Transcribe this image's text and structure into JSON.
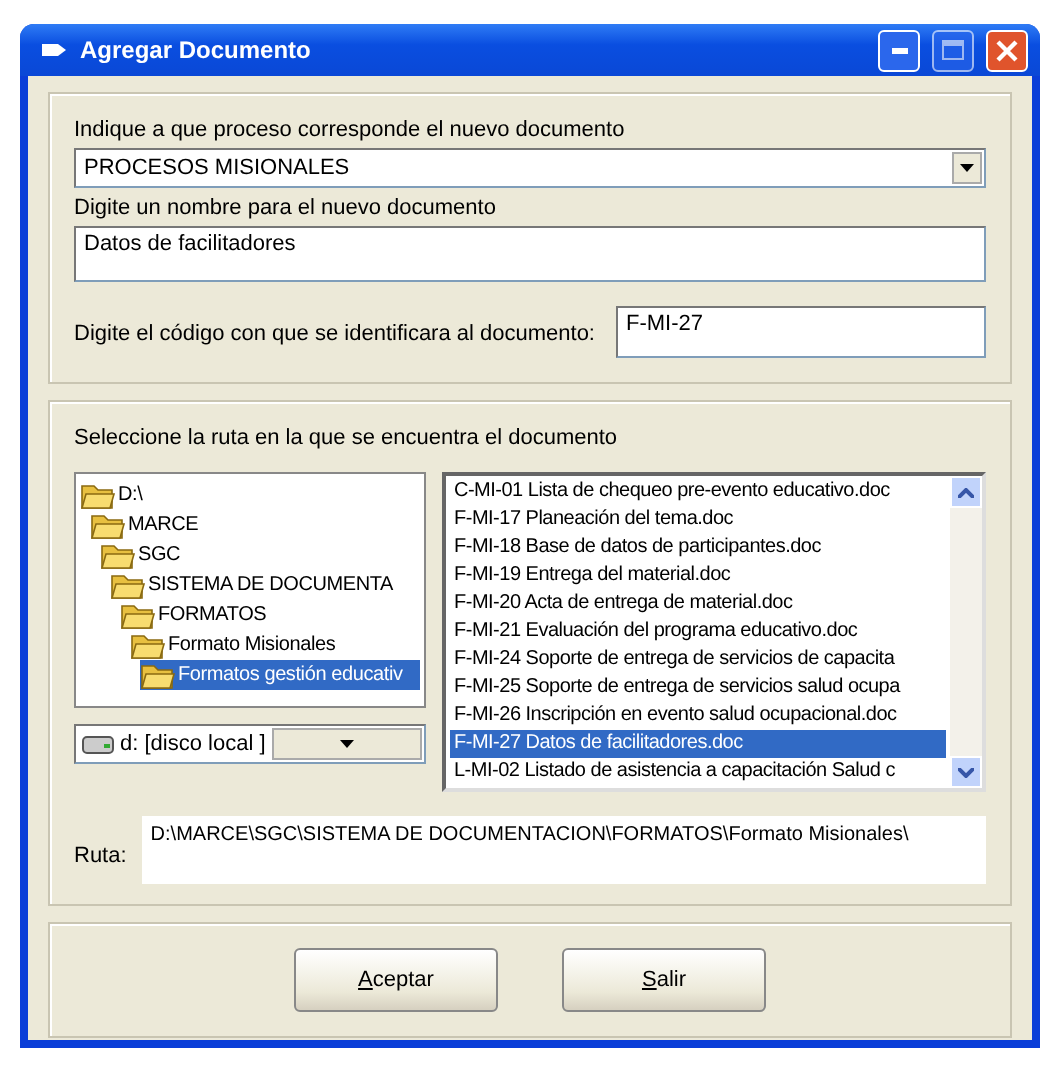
{
  "window": {
    "title": "Agregar Documento"
  },
  "process": {
    "label": "Indique a que proceso corresponde el nuevo documento",
    "value": "PROCESOS MISIONALES"
  },
  "name": {
    "label": "Digite un nombre para el nuevo documento",
    "value": "Datos de facilitadores"
  },
  "code": {
    "label": "Digite el código con que se identificara al documento:",
    "value": "F-MI-27"
  },
  "location": {
    "label": "Seleccione la ruta en la que se encuentra el documento",
    "folders": [
      {
        "label": "D:\\",
        "selected": false,
        "children": [
          {
            "label": "MARCE",
            "selected": false,
            "children": [
              {
                "label": "SGC",
                "selected": false,
                "children": [
                  {
                    "label": "SISTEMA DE DOCUMENTA",
                    "selected": false,
                    "children": [
                      {
                        "label": "FORMATOS",
                        "selected": false,
                        "children": [
                          {
                            "label": "Formato Misionales",
                            "selected": false,
                            "children": [
                              {
                                "label": "Formatos gestión educativ",
                                "selected": true
                              }
                            ]
                          }
                        ]
                      }
                    ]
                  }
                ]
              }
            ]
          }
        ]
      }
    ],
    "drive": "d: [disco local ]",
    "files": [
      {
        "name": "C-MI-01 Lista de chequeo pre-evento educativo.doc",
        "selected": false
      },
      {
        "name": "F-MI-17 Planeación del tema.doc",
        "selected": false
      },
      {
        "name": "F-MI-18 Base de datos de participantes.doc",
        "selected": false
      },
      {
        "name": "F-MI-19 Entrega del material.doc",
        "selected": false
      },
      {
        "name": "F-MI-20 Acta de entrega de material.doc",
        "selected": false
      },
      {
        "name": "F-MI-21 Evaluación del programa educativo.doc",
        "selected": false
      },
      {
        "name": "F-MI-24 Soporte de entrega de servicios de capacita",
        "selected": false
      },
      {
        "name": "F-MI-25 Soporte de entrega de servicios salud ocupa",
        "selected": false
      },
      {
        "name": "F-MI-26 Inscripción en evento salud ocupacional.doc",
        "selected": false
      },
      {
        "name": "F-MI-27 Datos de facilitadores.doc",
        "selected": true
      },
      {
        "name": "L-MI-02 Listado de asistencia a capacitación Salud c",
        "selected": false
      }
    ],
    "path_label": "Ruta:",
    "path": "D:\\MARCE\\SGC\\SISTEMA DE DOCUMENTACION\\FORMATOS\\Formato Misionales\\"
  },
  "buttons": [
    {
      "label": "Aceptar"
    },
    {
      "label": "Salir"
    }
  ]
}
